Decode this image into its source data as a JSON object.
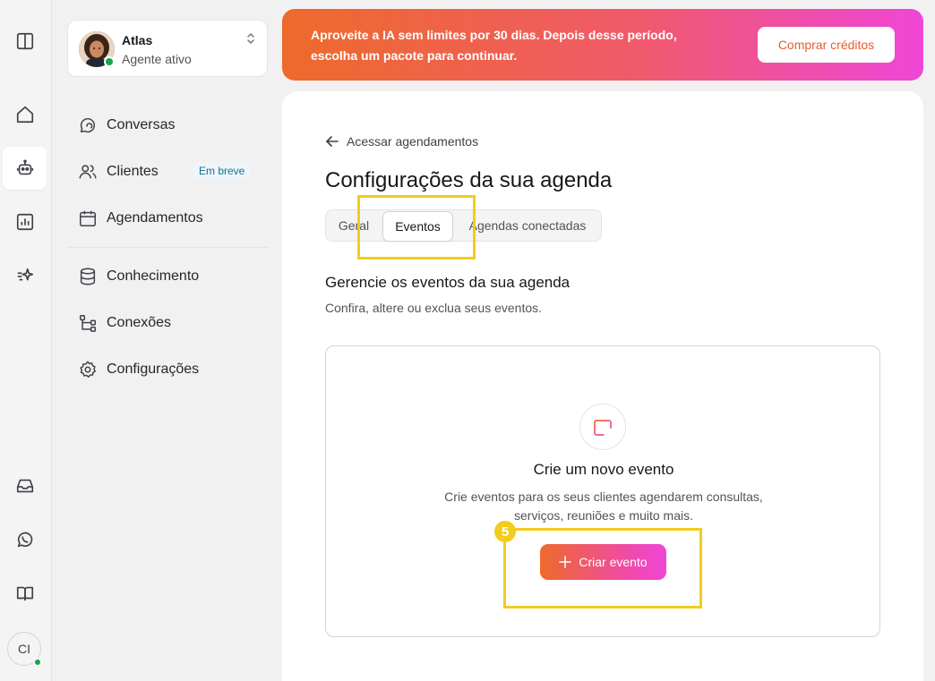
{
  "rail": {
    "user_initials": "CI"
  },
  "agent": {
    "name": "Atlas",
    "status": "Agente ativo"
  },
  "nav": {
    "conversas": "Conversas",
    "clientes": "Clientes",
    "clientes_badge": "Em breve",
    "agendamentos": "Agendamentos",
    "conhecimento": "Conhecimento",
    "conexoes": "Conexões",
    "configuracoes": "Configurações"
  },
  "banner": {
    "text": "Aproveite a IA sem limites por 30 dias. Depois desse período, escolha um pacote para continuar.",
    "button": "Comprar créditos"
  },
  "main": {
    "back_link": "Acessar agendamentos",
    "title": "Configurações da sua agenda",
    "tabs": [
      {
        "label": "Geral"
      },
      {
        "label": "Eventos"
      },
      {
        "label": "Agendas conectadas"
      }
    ],
    "active_tab": "Eventos",
    "section_title": "Gerencie os eventos da sua agenda",
    "section_subtitle": "Confira, altere ou exclua seus eventos.",
    "empty_state": {
      "title": "Crie um novo evento",
      "description": "Crie eventos para os seus clientes agendarem consultas, serviços, reuniões e muito mais.",
      "button": "Criar evento"
    }
  },
  "annotation": {
    "step": "5"
  },
  "colors": {
    "accent_orange": "#ee6a2a",
    "accent_pink": "#f046d8",
    "highlight": "#f3cc1d",
    "online": "#16a34a"
  }
}
